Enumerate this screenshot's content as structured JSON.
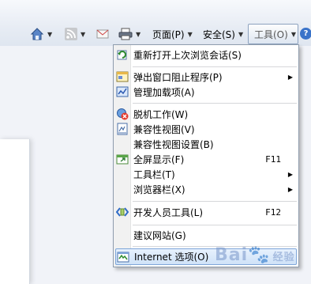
{
  "toolbar": {
    "page_label": "页面(P)",
    "safety_label": "安全(S)",
    "tools_label": "工具(O)",
    "help_label": "?"
  },
  "menu": {
    "items": [
      {
        "label": "重新打开上次浏览会话(S)",
        "icon": "reopen-session-icon"
      },
      {
        "label": "弹出窗口阻止程序(P)",
        "icon": "popup-blocker-icon",
        "submenu": true
      },
      {
        "label": "管理加载项(A)",
        "icon": "manage-addons-icon"
      },
      {
        "label": "脱机工作(W)",
        "icon": "work-offline-icon"
      },
      {
        "label": "兼容性视图(V)",
        "icon": "compat-view-icon"
      },
      {
        "label": "兼容性视图设置(B)",
        "icon": ""
      },
      {
        "label": "全屏显示(F)",
        "icon": "fullscreen-icon",
        "shortcut": "F11"
      },
      {
        "label": "工具栏(T)",
        "icon": "",
        "submenu": true
      },
      {
        "label": "浏览器栏(X)",
        "icon": "",
        "submenu": true
      },
      {
        "label": "开发人员工具(L)",
        "icon": "developer-tools-icon",
        "shortcut": "F12"
      },
      {
        "label": "建议网站(G)",
        "icon": ""
      },
      {
        "label": "Internet 选项(O)",
        "icon": "internet-options-icon"
      }
    ]
  },
  "watermark": {
    "text": "Bai",
    "text2": "经验"
  },
  "colors": {
    "highlight": "#cfe2f8",
    "accent": "#3a73c9",
    "separator": "#d6d7da"
  }
}
